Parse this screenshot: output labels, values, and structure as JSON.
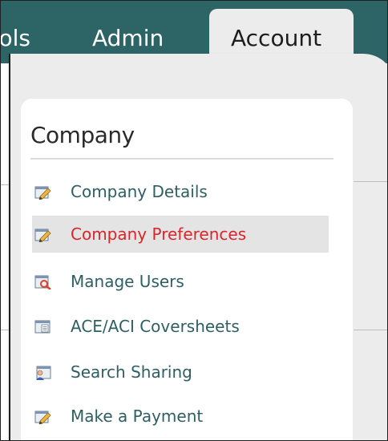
{
  "nav": {
    "tabs": [
      {
        "label": "Tools"
      },
      {
        "label": "Admin"
      },
      {
        "label": "Account",
        "active": true
      }
    ]
  },
  "dropdown": {
    "section_title": "Company",
    "items": [
      {
        "label": "Company Details",
        "icon": "edit-document-icon",
        "active": false
      },
      {
        "label": "Company Preferences",
        "icon": "edit-document-icon",
        "active": true
      },
      {
        "label": "Manage Users",
        "icon": "search-users-icon",
        "active": false
      },
      {
        "label": "ACE/ACI Coversheets",
        "icon": "coversheet-document-icon",
        "active": false
      },
      {
        "label": "Search Sharing",
        "icon": "user-share-icon",
        "active": false
      },
      {
        "label": "Make a Payment",
        "icon": "edit-document-icon",
        "active": false
      }
    ]
  },
  "colors": {
    "navbar": "#2d6566",
    "active_item_text": "#d8262b",
    "item_text": "#2f5f63",
    "dropdown_bg": "#ececec"
  }
}
